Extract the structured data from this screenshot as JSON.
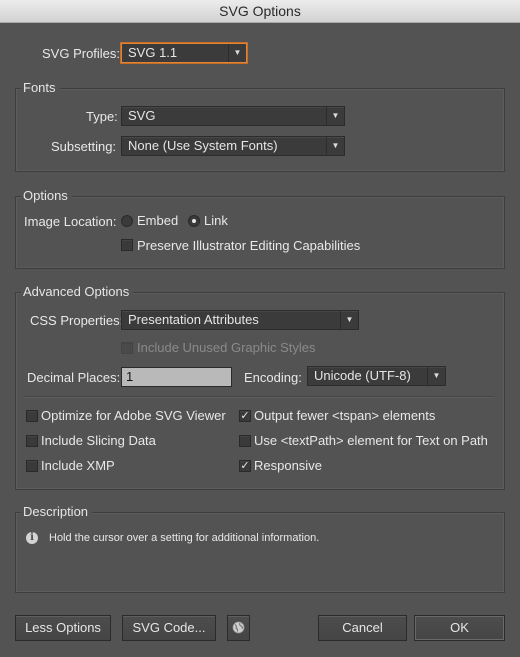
{
  "window": {
    "title": "SVG Options"
  },
  "profiles": {
    "label": "SVG Profiles:",
    "value": "SVG 1.1"
  },
  "fonts": {
    "group_title": "Fonts",
    "type_label": "Type:",
    "type_value": "SVG",
    "subsetting_label": "Subsetting:",
    "subsetting_value": "None (Use System Fonts)"
  },
  "options": {
    "group_title": "Options",
    "image_location_label": "Image Location:",
    "embed_label": "Embed",
    "link_label": "Link",
    "preserve_label": "Preserve Illustrator Editing Capabilities"
  },
  "advanced": {
    "group_title": "Advanced Options",
    "css_label": "CSS Properties:",
    "css_value": "Presentation Attributes",
    "include_unused_label": "Include Unused Graphic Styles",
    "decimal_label": "Decimal Places:",
    "decimal_value": "1",
    "encoding_label": "Encoding:",
    "encoding_value": "Unicode (UTF-8)",
    "optimize_label": "Optimize for Adobe SVG Viewer",
    "slicing_label": "Include Slicing Data",
    "xmp_label": "Include XMP",
    "tspan_label": "Output fewer <tspan> elements",
    "textpath_label": "Use <textPath> element for Text on Path",
    "responsive_label": "Responsive"
  },
  "description": {
    "group_title": "Description",
    "text": "Hold the cursor over a setting for additional information."
  },
  "buttons": {
    "less_options": "Less Options",
    "svg_code": "SVG Code...",
    "cancel": "Cancel",
    "ok": "OK"
  },
  "icons": {
    "info": "info-icon",
    "globe": "globe-icon"
  },
  "colors": {
    "background": "#535353",
    "focus_ring": "#e0863a"
  }
}
